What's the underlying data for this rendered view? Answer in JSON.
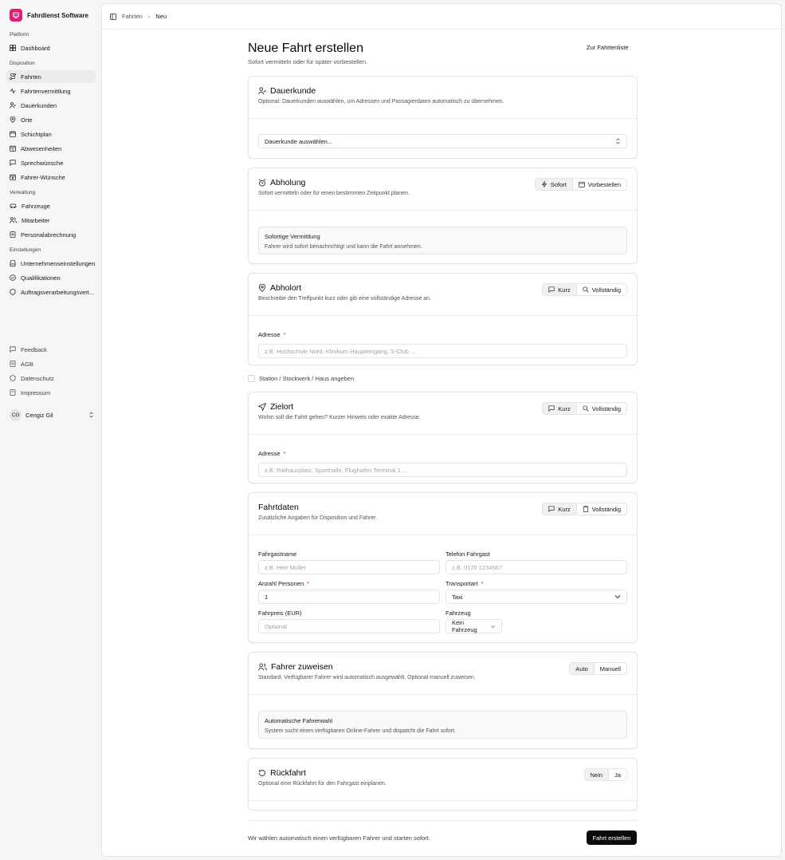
{
  "app": {
    "name": "Fahrdienst Software"
  },
  "sidebar": {
    "groups": [
      {
        "label": "Platform"
      },
      {
        "label": "Disposition"
      },
      {
        "label": "Verwaltung"
      },
      {
        "label": "Einstellungen"
      }
    ],
    "items": [
      {
        "label": "Dashboard"
      },
      {
        "label": "Fahrten"
      },
      {
        "label": "Fahrtenvermittlung"
      },
      {
        "label": "Dauerkunden"
      },
      {
        "label": "Orte"
      },
      {
        "label": "Schichtplan"
      },
      {
        "label": "Abwesenheiten"
      },
      {
        "label": "Sprechwünsche"
      },
      {
        "label": "Fahrer-Wünsche"
      },
      {
        "label": "Fahrzeuge"
      },
      {
        "label": "Mitarbeiter"
      },
      {
        "label": "Personalabrechnung"
      },
      {
        "label": "Unternehmenseinstellungen"
      },
      {
        "label": "Qualifikationen"
      },
      {
        "label": "Auftragsverarbeitungsvert..."
      }
    ],
    "footer": [
      {
        "label": "Feedback"
      },
      {
        "label": "AGB"
      },
      {
        "label": "Datenschutz"
      },
      {
        "label": "Impressum"
      }
    ],
    "user": {
      "initials": "CG",
      "name": "Cengiz Gil"
    }
  },
  "breadcrumb": {
    "parent": "Fahrten",
    "current": "Neu"
  },
  "page": {
    "title": "Neue Fahrt erstellen",
    "subtitle": "Sofort vermitteln oder für später vorbestellen.",
    "back_link": "Zur Fahrtenliste"
  },
  "dauerkunde": {
    "title": "Dauerkunde",
    "subtitle": "Optional: Dauerkunden auswählen, um Adressen und Passagierdaten automatisch zu übernehmen.",
    "select": "Dauerkunde auswählen..."
  },
  "abholung": {
    "title": "Abholung",
    "subtitle": "Sofort vermitteln oder für einen bestimmten Zeitpunkt planen.",
    "opt_now": "Sofort",
    "opt_later": "Vorbestellen",
    "info_title": "Sofortige Vermittlung",
    "info_text": "Fahrer wird sofort benachrichtigt und kann die Fahrt annehmen."
  },
  "abholort": {
    "title": "Abholort",
    "subtitle": "Beschreibe den Treffpunkt kurz oder gib eine vollständige Adresse an.",
    "opt_short": "Kurz",
    "opt_full": "Vollständig",
    "address_label": "Adresse",
    "address_placeholder": "z.B. Hochschule Nord, Klinikum Haupteingang, S-Club ..."
  },
  "station_checkbox": "Station / Stockwerk / Haus angeben",
  "zielort": {
    "title": "Zielort",
    "subtitle": "Wohin soll die Fahrt gehen? Kurzer Hinweis oder exakte Adresse.",
    "opt_short": "Kurz",
    "opt_full": "Vollständig",
    "address_label": "Adresse",
    "address_placeholder": "z.B. Rathausplatz, Sporthalle, Flughafen Terminal 1 ..."
  },
  "fahrtdaten": {
    "title": "Fahrtdaten",
    "subtitle": "Zusätzliche Angaben für Disposition und Fahrer.",
    "opt_short": "Kurz",
    "opt_full": "Vollständig",
    "name_label": "Fahrgastname",
    "name_placeholder": "z.B. Herr Müller",
    "phone_label": "Telefon Fahrgast",
    "phone_placeholder": "z.B. 0170 1234567",
    "persons_label": "Anzahl Personen",
    "persons_value": "1",
    "transport_label": "Transportart",
    "transport_value": "Taxi",
    "price_label": "Fahrpreis (EUR)",
    "price_placeholder": "Optional",
    "vehicle_label": "Fahrzeug",
    "vehicle_value": "Kein Fahrzeug"
  },
  "fahrer": {
    "title": "Fahrer zuweisen",
    "subtitle": "Standard: Verfügbarer Fahrer wird automatisch ausgewählt. Optional manuell zuweisen.",
    "opt_auto": "Auto",
    "opt_manual": "Manuell",
    "info_title": "Automatische Fahrerwahl",
    "info_text": "System sucht einen verfügbaren Online-Fahrer und dispatcht die Fahrt sofort."
  },
  "rueckfahrt": {
    "title": "Rückfahrt",
    "subtitle": "Optional eine Rückfahrt für den Fahrgast einplanen.",
    "opt_no": "Nein",
    "opt_yes": "Ja"
  },
  "footer": {
    "note": "Wir wählen automatisch einen verfügbaren Fahrer und starten sofort.",
    "submit": "Fahrt erstellen"
  }
}
